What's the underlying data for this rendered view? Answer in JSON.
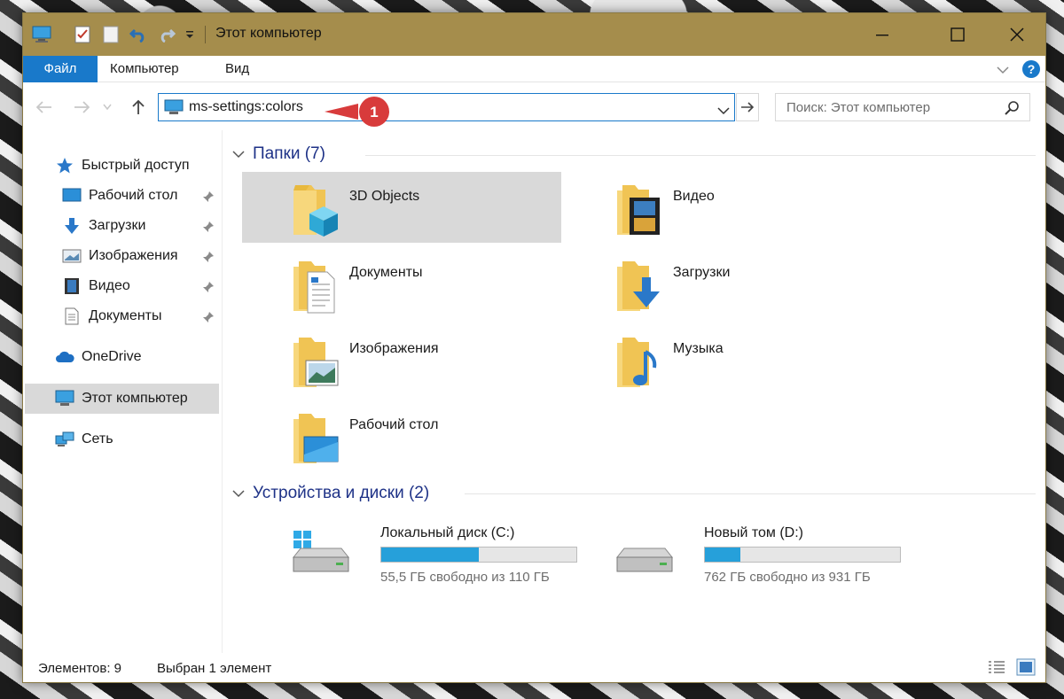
{
  "window": {
    "title": "Этот компьютер",
    "accent": "#a58d4c"
  },
  "ribbon": {
    "tabs": [
      "Файл",
      "Компьютер",
      "Вид"
    ]
  },
  "address": {
    "value": "ms-settings:colors",
    "badge": "1"
  },
  "search": {
    "placeholder": "Поиск: Этот компьютер"
  },
  "sidebar": {
    "items": [
      {
        "label": "Быстрый доступ",
        "icon": "star-icon"
      },
      {
        "label": "Рабочий стол",
        "icon": "desktop-icon",
        "pinned": true
      },
      {
        "label": "Загрузки",
        "icon": "download-icon",
        "pinned": true
      },
      {
        "label": "Изображения",
        "icon": "pictures-icon",
        "pinned": true
      },
      {
        "label": "Видео",
        "icon": "video-icon",
        "pinned": true
      },
      {
        "label": "Документы",
        "icon": "documents-icon",
        "pinned": true
      },
      {
        "label": "OneDrive",
        "icon": "cloud-icon"
      },
      {
        "label": "Этот компьютер",
        "icon": "computer-icon",
        "selected": true
      },
      {
        "label": "Сеть",
        "icon": "network-icon"
      }
    ]
  },
  "folders": {
    "header": "Папки (7)",
    "items": [
      {
        "label": "3D Objects",
        "icon": "3d-objects-icon",
        "selected": true
      },
      {
        "label": "Видео",
        "icon": "video-folder-icon"
      },
      {
        "label": "Документы",
        "icon": "documents-folder-icon"
      },
      {
        "label": "Загрузки",
        "icon": "downloads-folder-icon"
      },
      {
        "label": "Изображения",
        "icon": "pictures-folder-icon"
      },
      {
        "label": "Музыка",
        "icon": "music-folder-icon"
      },
      {
        "label": "Рабочий стол",
        "icon": "desktop-folder-icon"
      }
    ]
  },
  "drives": {
    "header": "Устройства и диски (2)",
    "items": [
      {
        "name": "Локальный диск (C:)",
        "free": "55,5 ГБ свободно из 110 ГБ",
        "used_fraction": 0.5,
        "icon": "system-drive-icon"
      },
      {
        "name": "Новый том (D:)",
        "free": "762 ГБ свободно из 931 ГБ",
        "used_fraction": 0.18,
        "icon": "drive-icon"
      }
    ]
  },
  "status": {
    "count": "Элементов: 9",
    "selected": "Выбран 1 элемент"
  }
}
